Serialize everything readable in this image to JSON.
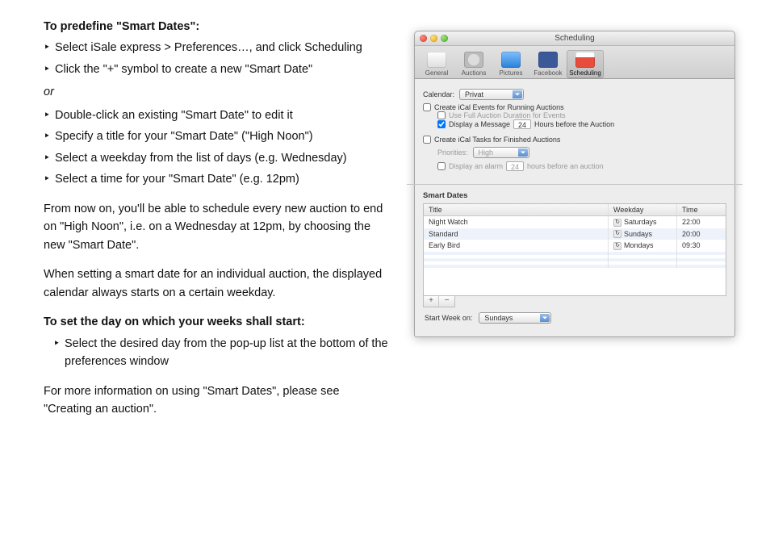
{
  "doc": {
    "h1": "To predefine \"Smart Dates\":",
    "steps1": [
      "Select iSale express  > Preferences…, and click Scheduling",
      "Click the \"+\" symbol to create a new \"Smart Date\""
    ],
    "or": "or",
    "steps2": [
      "Double-click an existing \"Smart Date\" to edit it",
      "Specify a title for your \"Smart Date\" (\"High Noon\")",
      "Select a weekday from the list of days (e.g. Wednesday)",
      "Select a time for your \"Smart Date\" (e.g. 12pm)"
    ],
    "p1": "From now on, you'll be able to schedule every new auction to end on \"High Noon\", i.e. on a Wednesday at 12pm, by choosing the new \"Smart Date\".",
    "p2": "When setting a smart date for an individual auction, the displayed calendar always starts on a certain weekday.",
    "h2": "To set the day on which your weeks shall start:",
    "steps3": [
      "Select the desired day from the pop-up list at the bottom of the preferences window"
    ],
    "p3": "For more information on using \"Smart Dates\", please see \"Creating an auction\"."
  },
  "window": {
    "title": "Scheduling",
    "toolbar": {
      "items": [
        {
          "label": "General"
        },
        {
          "label": "Auctions"
        },
        {
          "label": "Pictures"
        },
        {
          "label": "Facebook"
        },
        {
          "label": "Scheduling"
        }
      ],
      "active_index": 4
    },
    "calendar": {
      "label": "Calendar:",
      "value": "Privat"
    },
    "ical_events": {
      "label": "Create iCal Events for Running Auctions",
      "checked": false,
      "full_duration": {
        "label": "Use Full Auction Duration for Events",
        "checked": false
      },
      "display_msg": {
        "label_before": "Display a Message",
        "value": "24",
        "label_after": "Hours before the Auction",
        "checked": true
      }
    },
    "ical_tasks": {
      "label": "Create iCal Tasks for Finished Auctions",
      "checked": false,
      "priorities": {
        "label": "Priorities:",
        "value": "High"
      },
      "display_alarm": {
        "label_before": "Display an alarm",
        "value": "24",
        "label_after": "hours before an auction",
        "checked": false
      }
    },
    "smart_dates": {
      "title": "Smart Dates",
      "columns": [
        "Title",
        "Weekday",
        "Time"
      ],
      "rows": [
        {
          "title": "Night Watch",
          "weekday": "Saturdays",
          "time": "22:00"
        },
        {
          "title": "Standard",
          "weekday": "Sundays",
          "time": "20:00"
        },
        {
          "title": "Early Bird",
          "weekday": "Mondays",
          "time": "09:30"
        }
      ],
      "add": "+",
      "remove": "−"
    },
    "start_week": {
      "label": "Start Week on:",
      "value": "Sundays"
    }
  }
}
